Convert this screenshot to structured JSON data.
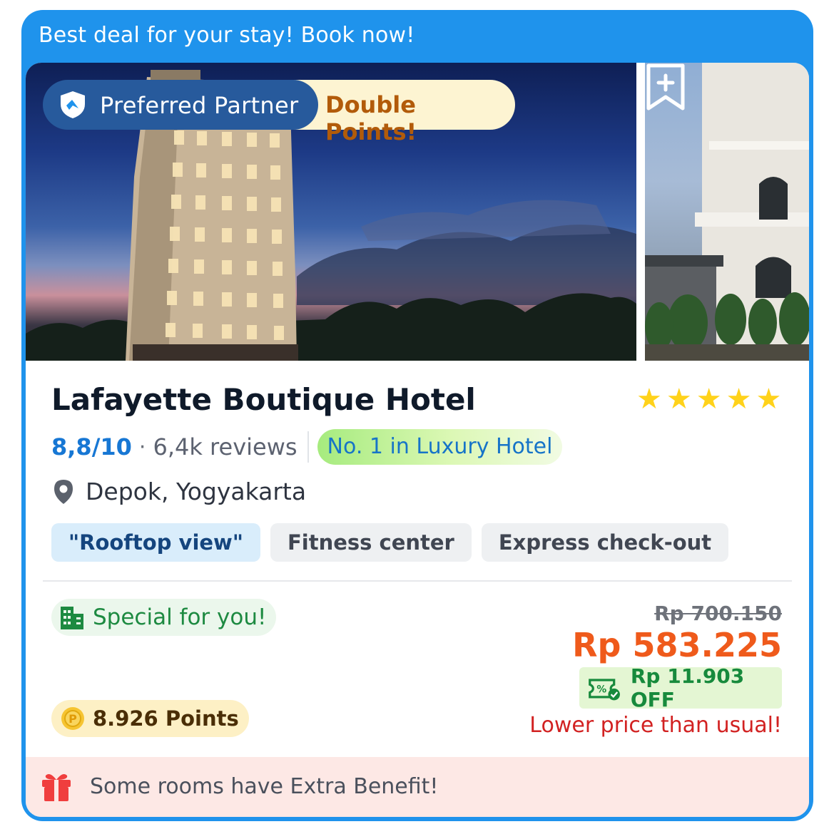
{
  "banner": {
    "text": "Best deal for your stay! Book now!"
  },
  "badges": {
    "partner": "Preferred Partner",
    "promo": "Double Points!"
  },
  "hotel": {
    "name": "Lafayette Boutique Hotel",
    "stars": 5,
    "rating": "8,8/10",
    "reviews": "6,4k reviews",
    "ranking": "No. 1 in Luxury Hotel",
    "location": "Depok, Yogyakarta"
  },
  "features": [
    "\"Rooftop view\"",
    "Fitness center",
    "Express check-out"
  ],
  "offer": {
    "special": "Special for you!",
    "points": "8.926 Points",
    "original_price": "Rp 700.150",
    "price": "Rp 583.225",
    "discount": "Rp 11.903 OFF",
    "note": "Lower price than usual!"
  },
  "footer": {
    "text": "Some rooms have Extra Benefit!"
  },
  "icons": {
    "partner": "shield-icon",
    "bookmark": "bookmark-add-icon",
    "location": "location-pin-icon",
    "special": "building-icon",
    "points": "coin-icon",
    "discount": "coupon-check-icon",
    "footer": "gift-icon"
  },
  "colors": {
    "banner": "#1f93ec",
    "price": "#ef5a1b",
    "rating": "#1777d4",
    "star": "#ffd21a",
    "lower_price": "#d22222",
    "discount_text": "#178a3c"
  }
}
